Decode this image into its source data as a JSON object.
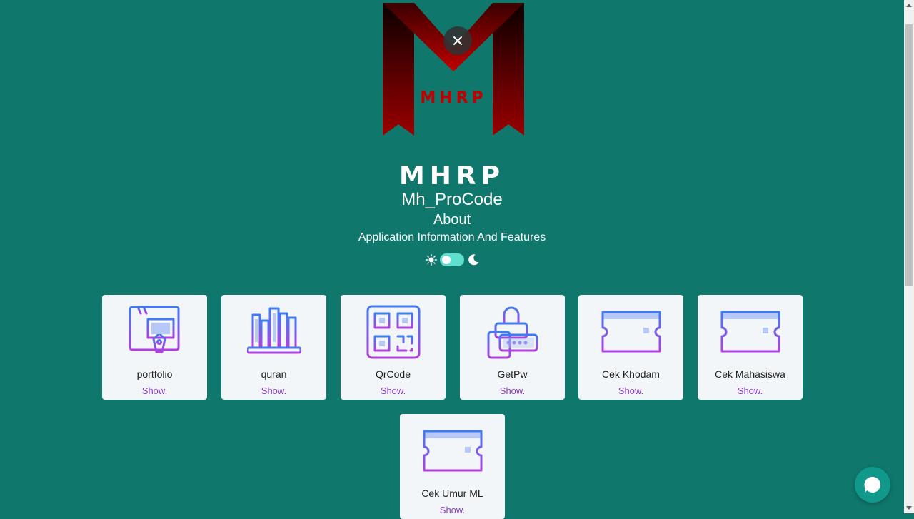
{
  "logo": {
    "text": "MHRP"
  },
  "brand": {
    "title": "MHRP",
    "subtitle": "Mh_ProCode"
  },
  "about": {
    "heading": "About",
    "description": "Application Information And Features"
  },
  "theme": {
    "light_icon": "sun-icon",
    "dark_icon": "moon-icon",
    "mode": "light"
  },
  "close": {
    "icon": "close-icon"
  },
  "cards": [
    {
      "name": "portfolio",
      "action": "Show.",
      "icon": "portfolio-icon"
    },
    {
      "name": "quran",
      "action": "Show.",
      "icon": "books-icon"
    },
    {
      "name": "QrCode",
      "action": "Show.",
      "icon": "qrcode-icon"
    },
    {
      "name": "GetPw",
      "action": "Show.",
      "icon": "password-lock-icon"
    },
    {
      "name": "Cek Khodam",
      "action": "Show.",
      "icon": "ticket-icon"
    },
    {
      "name": "Cek Mahasiswa",
      "action": "Show.",
      "icon": "ticket-icon"
    },
    {
      "name": "Cek Umur ML",
      "action": "Show.",
      "icon": "ticket-icon"
    }
  ],
  "chat": {
    "icon": "chat-icon"
  },
  "colors": {
    "background": "#10776d",
    "card": "#f3f6f8",
    "accent": "#8a3fcf",
    "icon_gradient_start": "#3f7bf2",
    "icon_gradient_end": "#b23fe0"
  }
}
